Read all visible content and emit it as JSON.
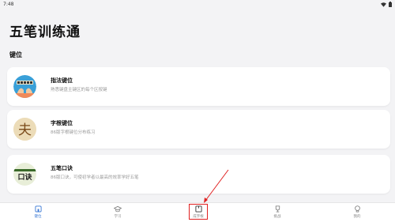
{
  "status": {
    "time": "7:48"
  },
  "app": {
    "title": "五笔训练通"
  },
  "section": {
    "label": "键位"
  },
  "cards": [
    {
      "title": "指法键位",
      "subtitle": "熟悉键盘主键区的每个区按键",
      "icon": "typing-hands-icon"
    },
    {
      "title": "字根键位",
      "subtitle": "86版字根键位分布练习",
      "icon": "radical-char-icon",
      "glyph": "夫"
    },
    {
      "title": "五笔口诀",
      "subtitle": "86版口诀，可使初学者以最高的效率学好五笔",
      "icon": "mnemonic-scroll-icon",
      "glyph": "口诀"
    }
  ],
  "nav": [
    {
      "label": "键位",
      "icon": "home-icon"
    },
    {
      "label": "学习",
      "icon": "graduation-cap-icon"
    },
    {
      "label": "成字根",
      "icon": "book-icon"
    },
    {
      "label": "挑战",
      "icon": "trophy-icon"
    },
    {
      "label": "我的",
      "icon": "profile-icon"
    }
  ],
  "colors": {
    "accent": "#3a78d4",
    "annotation": "#e02020"
  }
}
